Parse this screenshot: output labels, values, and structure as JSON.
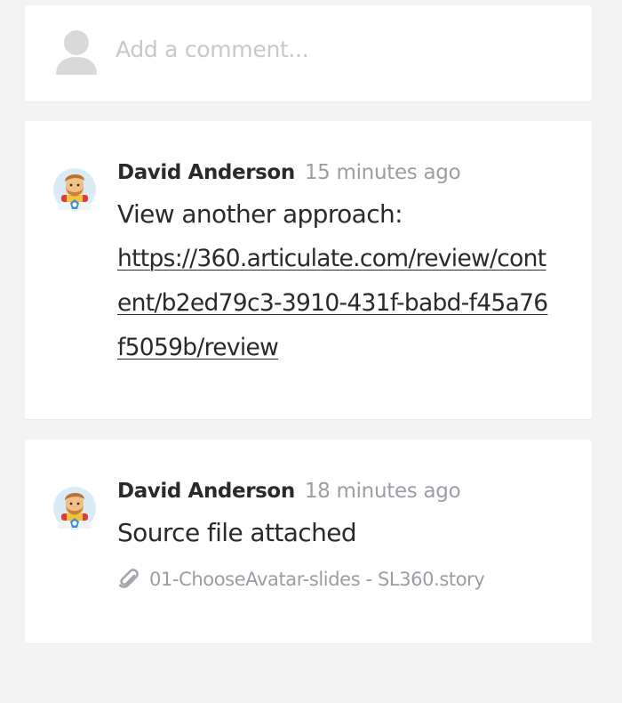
{
  "composer": {
    "placeholder": "Add a comment..."
  },
  "comments": [
    {
      "author": "David Anderson",
      "time": "15 minutes ago",
      "text": "View another approach:",
      "link": "https://360.articulate.com/review/content/b2ed79c3-3910-431f-babd-f45a76f5059b/review"
    },
    {
      "author": "David Anderson",
      "time": "18 minutes ago",
      "text": "Source file attached",
      "attachment": "01-ChooseAvatar-slides - SL360.story"
    }
  ],
  "icons": {
    "composer_avatar": "user-silhouette-icon",
    "comment_avatar": "user-avatar-icon",
    "attachment": "paperclip-icon"
  },
  "colors": {
    "background": "#f3f3f3",
    "card": "#ffffff",
    "text": "#2a2a2a",
    "muted": "#9a9ea3",
    "placeholder": "#c8c8c8"
  }
}
